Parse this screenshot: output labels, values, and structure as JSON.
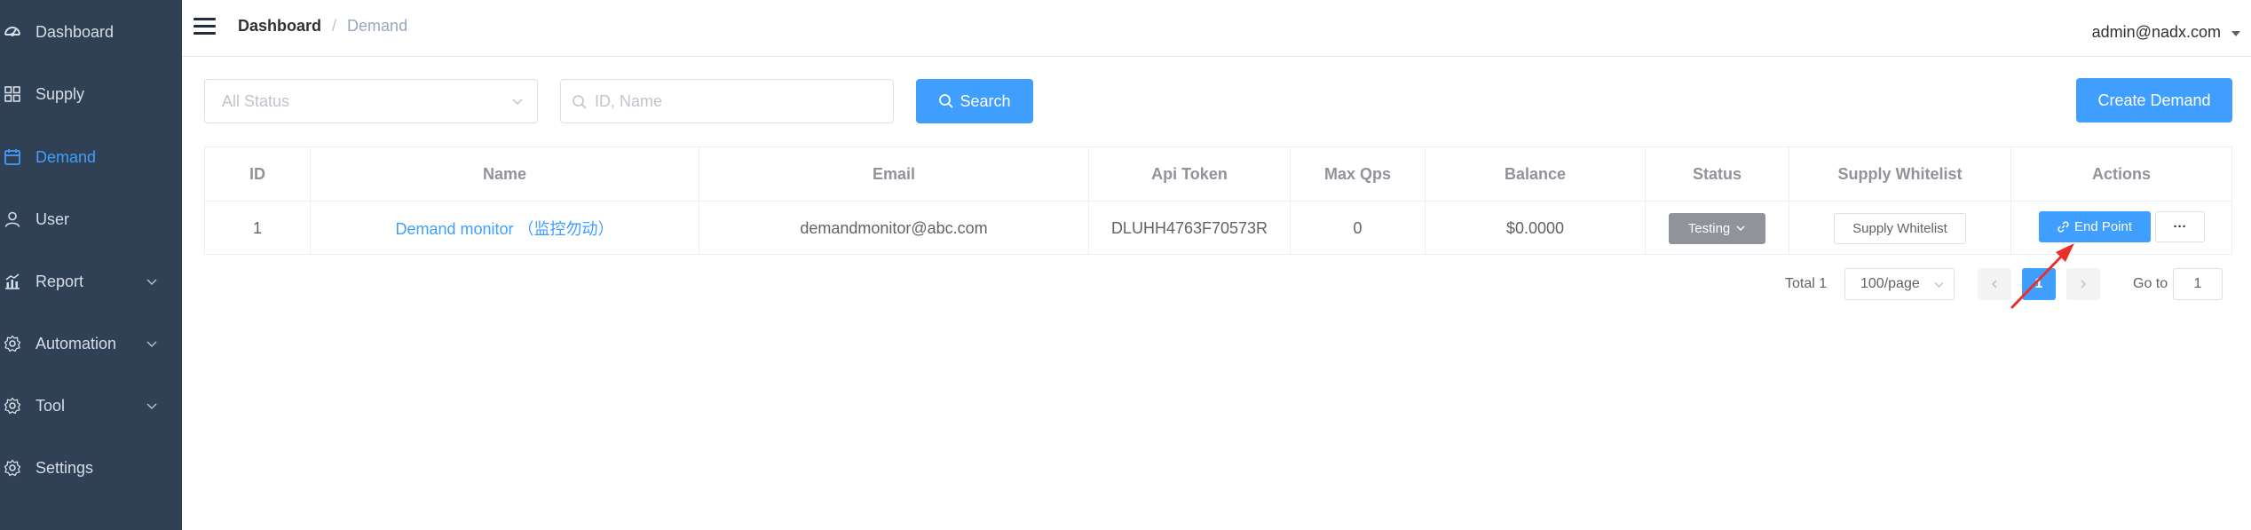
{
  "colors": {
    "sidebar_bg": "#304156",
    "accent": "#409eff",
    "status_tag": "#909399",
    "annotation_arrow": "#e8302a"
  },
  "sidebar": {
    "items": [
      {
        "label": "Dashboard",
        "icon": "dashboard-icon",
        "active": false,
        "has_submenu": false
      },
      {
        "label": "Supply",
        "icon": "grid-icon",
        "active": false,
        "has_submenu": false
      },
      {
        "label": "Demand",
        "icon": "calendar-icon",
        "active": true,
        "has_submenu": false
      },
      {
        "label": "User",
        "icon": "user-icon",
        "active": false,
        "has_submenu": false
      },
      {
        "label": "Report",
        "icon": "chart-icon",
        "active": false,
        "has_submenu": true
      },
      {
        "label": "Automation",
        "icon": "gear-icon",
        "active": false,
        "has_submenu": true
      },
      {
        "label": "Tool",
        "icon": "gear-icon",
        "active": false,
        "has_submenu": true
      },
      {
        "label": "Settings",
        "icon": "gear-icon",
        "active": false,
        "has_submenu": false
      }
    ]
  },
  "header": {
    "breadcrumb": [
      "Dashboard",
      "Demand"
    ],
    "breadcrumb_separator": "/",
    "user": "admin@nadx.com"
  },
  "filters": {
    "status_placeholder": "All Status",
    "search_placeholder": "ID, Name",
    "search_button": "Search",
    "create_button": "Create Demand"
  },
  "table": {
    "columns": [
      "ID",
      "Name",
      "Email",
      "Api Token",
      "Max Qps",
      "Balance",
      "Status",
      "Supply Whitelist",
      "Actions"
    ],
    "rows": [
      {
        "id": "1",
        "name": "Demand monitor （监控勿动）",
        "email": "demandmonitor@abc.com",
        "api_token": "DLUHH4763F70573R",
        "max_qps": "0",
        "balance": "$0.0000",
        "status": "Testing",
        "supply_whitelist": "Supply Whitelist",
        "endpoint_button": "End Point",
        "more_button": "···"
      }
    ]
  },
  "pagination": {
    "total": "Total 1",
    "page_size": "100/page",
    "current_page": "1",
    "goto_label": "Go to",
    "goto_value": "1"
  }
}
